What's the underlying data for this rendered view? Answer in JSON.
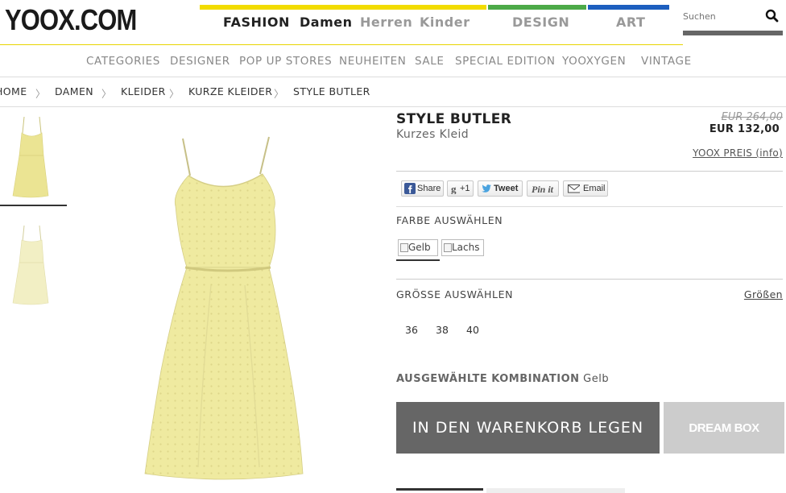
{
  "header": {
    "logo": "YOOX.COM",
    "nav": [
      "FASHION",
      "Damen",
      "Herren",
      "Kinder",
      "DESIGN",
      "ART"
    ],
    "bar_colors": {
      "fashion": "#f2dc00",
      "design": "#4caa48",
      "art": "#1d5fbf"
    },
    "search_placeholder": "Suchen"
  },
  "categories": [
    "CATEGORIES",
    "DESIGNER",
    "POP UP STORES",
    "NEUHEITEN",
    "SALE",
    "SPECIAL EDITION",
    "YOOXYGEN",
    "VINTAGE"
  ],
  "breadcrumb": {
    "items": [
      "HOME",
      "DAMEN",
      "KLEIDER",
      "KURZE KLEIDER",
      "STYLE BUTLER"
    ],
    "separator": "〉"
  },
  "product": {
    "brand": "STYLE BUTLER",
    "type": "Kurzes Kleid",
    "price_old": "EUR 264,00",
    "price_new": "EUR 132,00",
    "price_info": "YOOX PREIS (info)",
    "dress_color": "#efeaa0"
  },
  "social": {
    "share": "Share",
    "plusone": "+1",
    "tweet": "Tweet",
    "pinit": "Pin it",
    "email": "Email"
  },
  "color_section": {
    "label": "FARBE AUSWÄHLEN",
    "options": [
      "Gelb",
      "Lachs"
    ]
  },
  "size_section": {
    "label": "GRÖSSE AUSWÄHLEN",
    "guide": "Größen",
    "sizes": [
      "36",
      "38",
      "40"
    ]
  },
  "combination": {
    "label": "AUSGEWÄHLTE KOMBINATION",
    "value": "Gelb"
  },
  "buttons": {
    "cart": "IN DEN WARENKORB LEGEN",
    "dreambox": "DREAM BOX"
  }
}
